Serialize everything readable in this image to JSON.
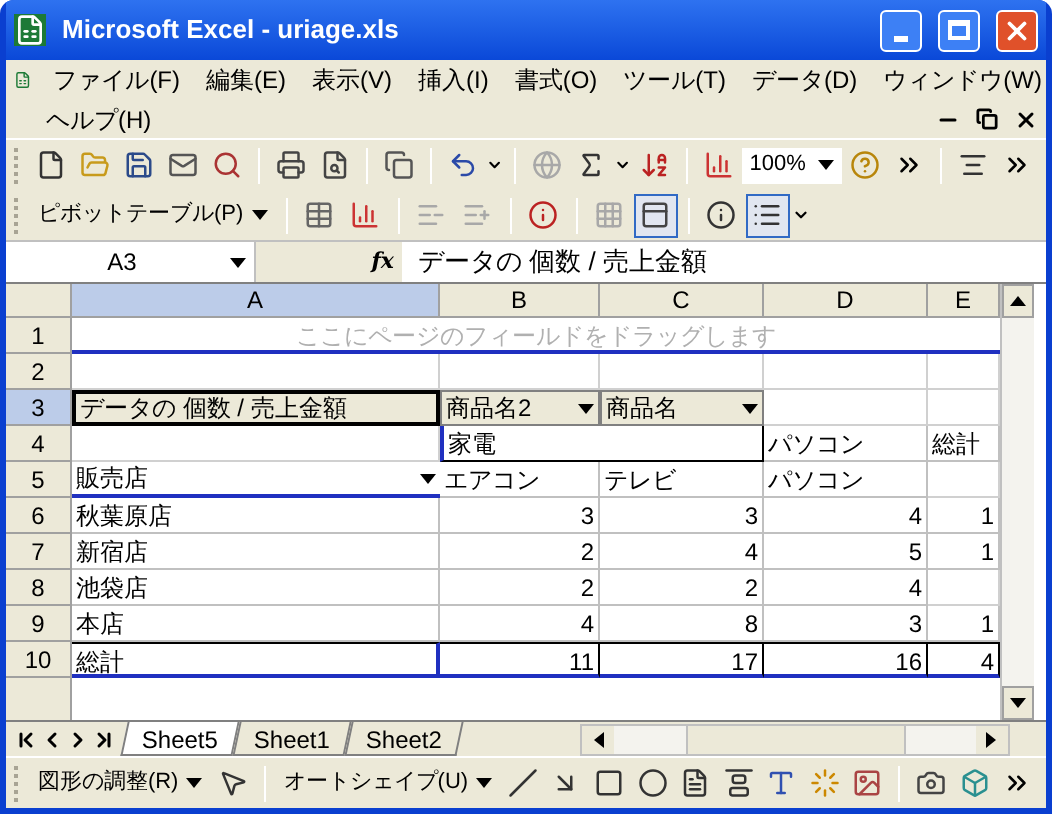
{
  "window": {
    "title": "Microsoft Excel - uriage.xls"
  },
  "menu": [
    {
      "label": "ファイル(F)"
    },
    {
      "label": "編集(E)"
    },
    {
      "label": "表示(V)"
    },
    {
      "label": "挿入(I)"
    },
    {
      "label": "書式(O)"
    },
    {
      "label": "ツール(T)"
    },
    {
      "label": "データ(D)"
    },
    {
      "label": "ウィンドウ(W)"
    },
    {
      "label": "ヘルプ(H)"
    }
  ],
  "standard_toolbar": [
    {
      "kind": "new",
      "disabled": false
    },
    {
      "kind": "open",
      "disabled": false
    },
    {
      "kind": "save",
      "disabled": false
    },
    {
      "kind": "mail",
      "disabled": false
    },
    {
      "kind": "research",
      "disabled": false
    },
    {
      "kind": "sep"
    },
    {
      "kind": "print",
      "disabled": false
    },
    {
      "kind": "preview",
      "disabled": false
    },
    {
      "kind": "sep"
    },
    {
      "kind": "copy",
      "disabled": false
    },
    {
      "kind": "sep"
    },
    {
      "kind": "undo",
      "disabled": false
    },
    {
      "kind": "caret",
      "disabled": false
    },
    {
      "kind": "sep"
    },
    {
      "kind": "link",
      "disabled": true
    },
    {
      "kind": "sum",
      "disabled": false
    },
    {
      "kind": "caret",
      "disabled": false
    },
    {
      "kind": "sort",
      "disabled": false
    },
    {
      "kind": "sep"
    },
    {
      "kind": "chart",
      "disabled": false
    },
    {
      "kind": "zoom",
      "value": "100%"
    },
    {
      "kind": "help",
      "disabled": false
    },
    {
      "kind": "more",
      "disabled": false
    },
    {
      "kind": "sep"
    },
    {
      "kind": "align",
      "disabled": false
    },
    {
      "kind": "more",
      "disabled": false
    }
  ],
  "pivot_toolbar": [
    {
      "kind": "menu",
      "label": "ピボットテーブル(P)"
    },
    {
      "kind": "sep"
    },
    {
      "kind": "pivot-format",
      "disabled": false,
      "pressed": false
    },
    {
      "kind": "chart",
      "disabled": false,
      "pressed": false
    },
    {
      "kind": "sep"
    },
    {
      "kind": "hide-detail",
      "disabled": true,
      "pressed": false
    },
    {
      "kind": "show-detail",
      "disabled": true,
      "pressed": false
    },
    {
      "kind": "sep"
    },
    {
      "kind": "refresh",
      "disabled": false,
      "pressed": false
    },
    {
      "kind": "sep"
    },
    {
      "kind": "grid",
      "disabled": true,
      "pressed": false
    },
    {
      "kind": "field-list",
      "disabled": false,
      "pressed": true
    },
    {
      "kind": "sep"
    },
    {
      "kind": "settings",
      "disabled": false,
      "pressed": false
    },
    {
      "kind": "list",
      "disabled": false,
      "pressed": true
    },
    {
      "kind": "caret",
      "disabled": false
    }
  ],
  "formula_bar": {
    "name_box": "A3",
    "function_label": "fx",
    "formula": "データの 個数 / 売上金額"
  },
  "columns": [
    {
      "label": "A",
      "selected": true
    },
    {
      "label": "B",
      "selected": false
    },
    {
      "label": "C",
      "selected": false
    },
    {
      "label": "D",
      "selected": false
    },
    {
      "label": "E",
      "selected": false
    }
  ],
  "rows": [
    {
      "label": "1",
      "selected": false,
      "cells": [
        {
          "kind": "hint",
          "text": "ここにページのフィールドをドラッグします"
        }
      ]
    },
    {
      "label": "2",
      "selected": false,
      "cells": [
        {
          "kind": "empty"
        },
        {
          "kind": "empty"
        },
        {
          "kind": "empty"
        },
        {
          "kind": "empty"
        },
        {
          "kind": "empty"
        }
      ]
    },
    {
      "label": "3",
      "selected": true,
      "cells": [
        {
          "kind": "data-field",
          "text": "データの 個数 / 売上金額"
        },
        {
          "kind": "field",
          "text": "商品名2"
        },
        {
          "kind": "field",
          "text": "商品名"
        },
        {
          "kind": "empty"
        },
        {
          "kind": "empty"
        }
      ]
    },
    {
      "label": "4",
      "selected": false,
      "cells": [
        {
          "kind": "empty"
        },
        {
          "kind": "group",
          "text": "家電"
        },
        {
          "kind": "text",
          "text": "パソコン"
        },
        {
          "kind": "text",
          "text": "総計"
        }
      ]
    },
    {
      "label": "5",
      "selected": false,
      "cells": [
        {
          "kind": "row-field",
          "text": "販売店"
        },
        {
          "kind": "text",
          "text": "エアコン"
        },
        {
          "kind": "text",
          "text": "テレビ"
        },
        {
          "kind": "text",
          "text": "パソコン"
        },
        {
          "kind": "empty"
        }
      ]
    },
    {
      "label": "6",
      "selected": false,
      "cells": [
        {
          "kind": "text",
          "text": "秋葉原店"
        },
        {
          "kind": "number",
          "text": "3"
        },
        {
          "kind": "number",
          "text": "3"
        },
        {
          "kind": "number",
          "text": "4"
        },
        {
          "kind": "number",
          "text": "1"
        }
      ]
    },
    {
      "label": "7",
      "selected": false,
      "cells": [
        {
          "kind": "text",
          "text": "新宿店"
        },
        {
          "kind": "number",
          "text": "2"
        },
        {
          "kind": "number",
          "text": "4"
        },
        {
          "kind": "number",
          "text": "5"
        },
        {
          "kind": "number",
          "text": "1"
        }
      ]
    },
    {
      "label": "8",
      "selected": false,
      "cells": [
        {
          "kind": "text",
          "text": "池袋店"
        },
        {
          "kind": "number",
          "text": "2"
        },
        {
          "kind": "number",
          "text": "2"
        },
        {
          "kind": "number",
          "text": "4"
        },
        {
          "kind": "empty"
        }
      ]
    },
    {
      "label": "9",
      "selected": false,
      "cells": [
        {
          "kind": "text",
          "text": "本店"
        },
        {
          "kind": "number",
          "text": "4"
        },
        {
          "kind": "number",
          "text": "8"
        },
        {
          "kind": "number",
          "text": "3"
        },
        {
          "kind": "number",
          "text": "1"
        }
      ]
    },
    {
      "label": "10",
      "selected": false,
      "cells": [
        {
          "kind": "total",
          "text": "総計"
        },
        {
          "kind": "total-number",
          "text": "11"
        },
        {
          "kind": "total-number",
          "text": "17"
        },
        {
          "kind": "total-number",
          "text": "16"
        },
        {
          "kind": "total-number",
          "text": "4"
        }
      ]
    }
  ],
  "sheet_tabs": [
    {
      "label": "Sheet5",
      "selected": true
    },
    {
      "label": "Sheet1",
      "selected": false
    },
    {
      "label": "Sheet2",
      "selected": false
    }
  ],
  "drawing_toolbar": [
    {
      "kind": "menu",
      "label": "図形の調整(R)"
    },
    {
      "kind": "pointer"
    },
    {
      "kind": "sep"
    },
    {
      "kind": "menu",
      "label": "オートシェイプ(U)"
    },
    {
      "kind": "line"
    },
    {
      "kind": "arrow"
    },
    {
      "kind": "rect"
    },
    {
      "kind": "oval"
    },
    {
      "kind": "textbox"
    },
    {
      "kind": "vtextbox"
    },
    {
      "kind": "wordart"
    },
    {
      "kind": "diagram"
    },
    {
      "kind": "clipart"
    },
    {
      "kind": "sep"
    },
    {
      "kind": "camera"
    },
    {
      "kind": "box3d"
    },
    {
      "kind": "more"
    }
  ]
}
